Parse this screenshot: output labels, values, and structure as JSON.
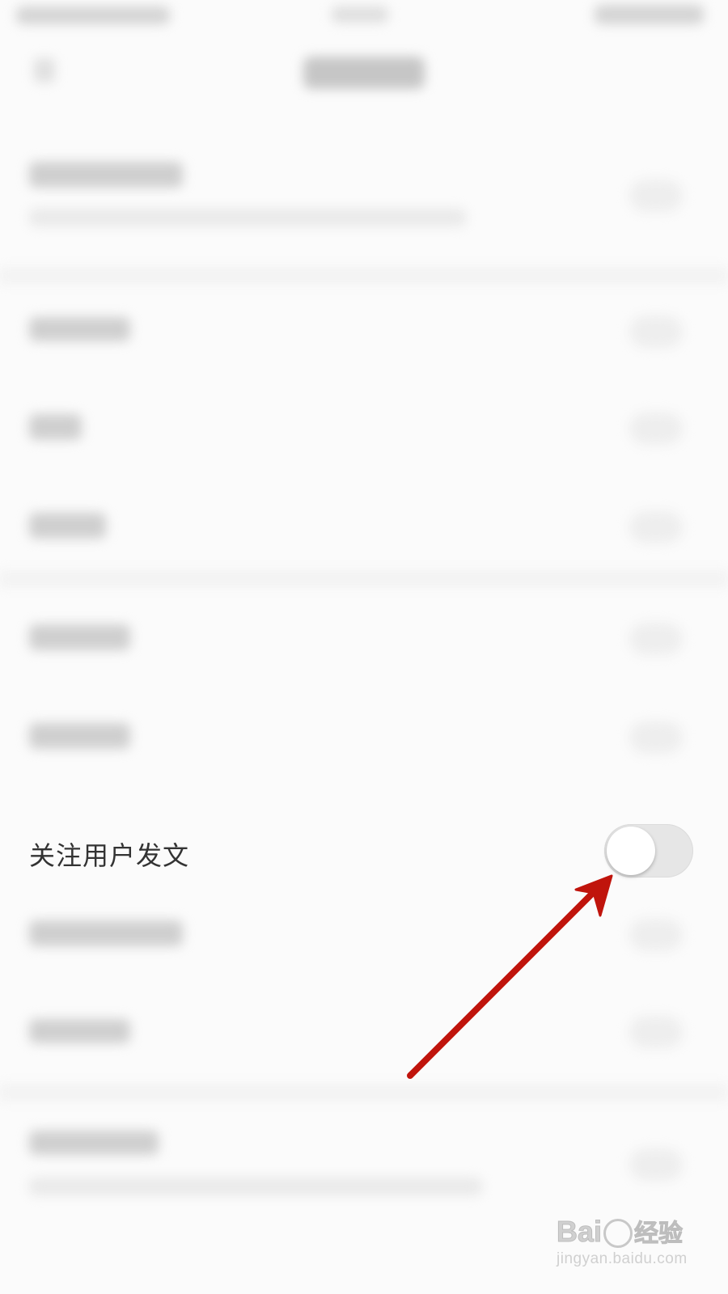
{
  "setting": {
    "label": "关注用户发文",
    "enabled": false
  },
  "colors": {
    "arrow": "#c0140c",
    "toggle_off_track": "#e6e6e6",
    "toggle_knob": "#ffffff",
    "label_text": "#333333"
  },
  "watermark": {
    "brand": "Bai",
    "brand_suffix": "经验",
    "site": "jingyan.baidu.com"
  }
}
